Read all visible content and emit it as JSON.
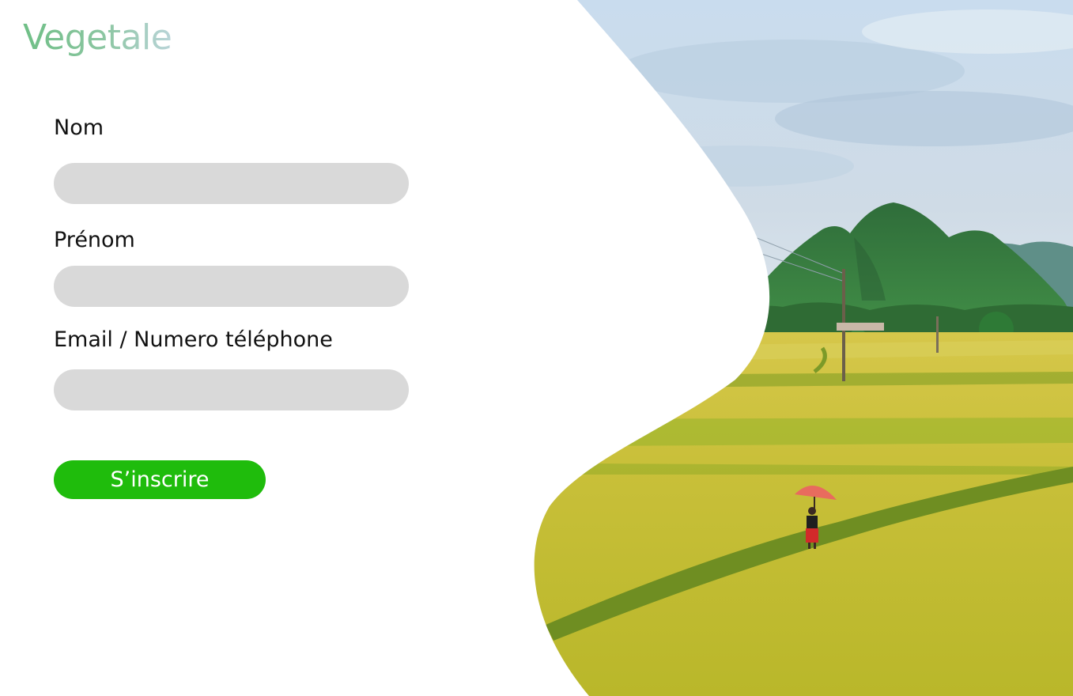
{
  "brand": {
    "name": "Vegetale"
  },
  "form": {
    "fields": [
      {
        "label": "Nom",
        "value": "",
        "placeholder": ""
      },
      {
        "label": "Prénom",
        "value": "",
        "placeholder": ""
      },
      {
        "label": "Email / Numero téléphone",
        "value": "",
        "placeholder": ""
      }
    ],
    "submit_label": "S’inscrire"
  },
  "colors": {
    "accent": "#1fbc0c",
    "input_bg": "#d9d9d9",
    "logo_start": "#6fbf86",
    "logo_end": "#b9d4d8"
  },
  "illustration": {
    "icon": "rice-field-landscape-image"
  }
}
